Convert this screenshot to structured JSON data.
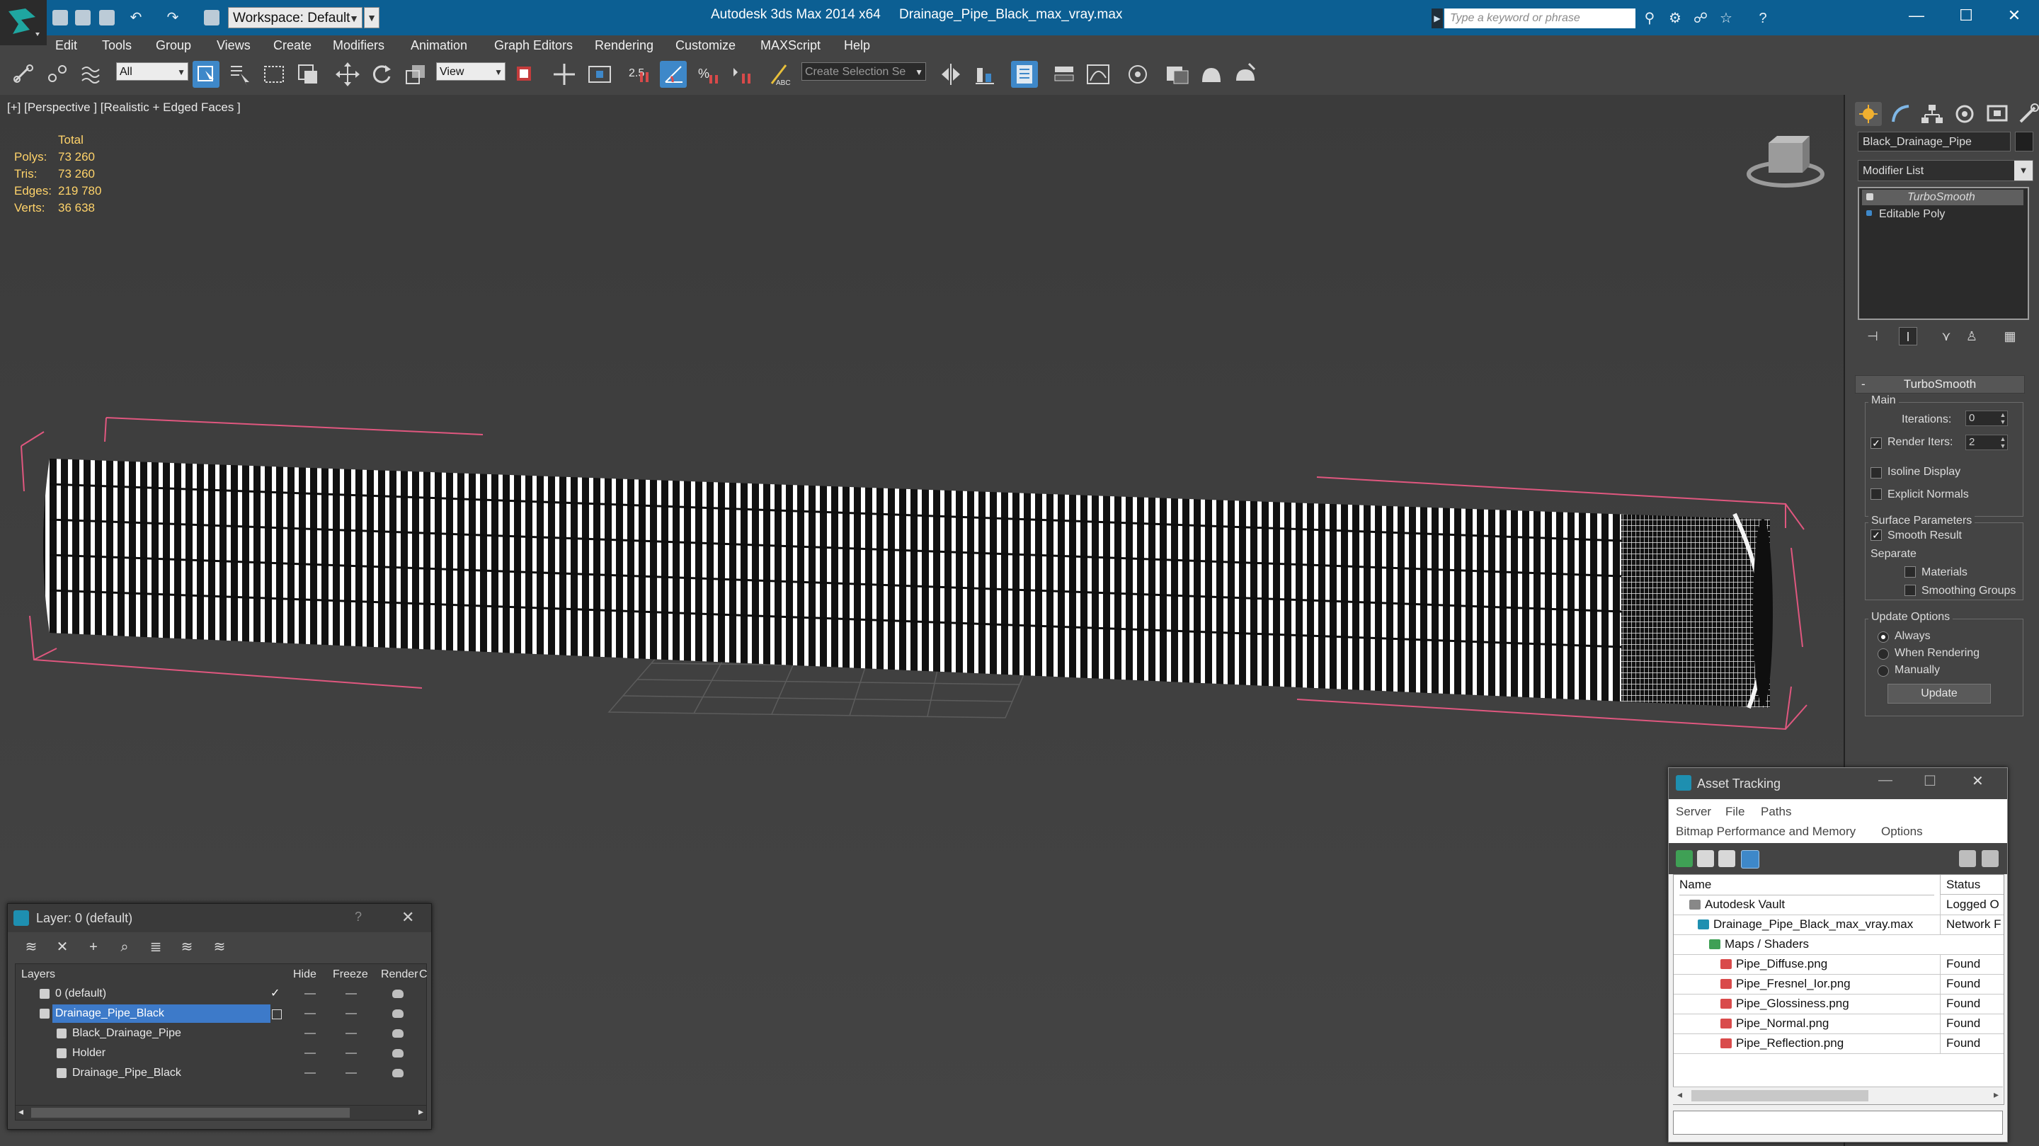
{
  "titlebar": {
    "workspace": "Workspace: Default",
    "app_title": "Autodesk 3ds Max  2014 x64",
    "file_title": "Drainage_Pipe_Black_max_vray.max",
    "search_placeholder": "Type a keyword or phrase",
    "minimize": "—",
    "maximize": "☐",
    "close": "✕"
  },
  "menu": [
    "Edit",
    "Tools",
    "Group",
    "Views",
    "Create",
    "Modifiers",
    "Animation",
    "Graph Editors",
    "Rendering",
    "Customize",
    "MAXScript",
    "Help"
  ],
  "toolbar": {
    "selection_filter": "All",
    "reference_coord": "View",
    "create_selection_set": "Create Selection Se",
    "snap_label": "2.5"
  },
  "viewport": {
    "label": "[+] [Perspective ] [Realistic + Edged Faces ]",
    "stats": {
      "header": "Total",
      "rows": [
        {
          "key": "Polys:",
          "value": "73 260"
        },
        {
          "key": "Tris:",
          "value": "73 260"
        },
        {
          "key": "Edges:",
          "value": "219 780"
        },
        {
          "key": "Verts:",
          "value": "36 638"
        }
      ]
    }
  },
  "command_panel": {
    "object_name": "Black_Drainage_Pipe",
    "modifier_list": "Modifier List",
    "stack": [
      "TurboSmooth",
      "Editable Poly"
    ],
    "rollout_title": "TurboSmooth",
    "main_group": "Main",
    "iterations_label": "Iterations:",
    "iterations_value": "0",
    "render_iters_label": "Render Iters:",
    "render_iters_value": "2",
    "isoline_display": "Isoline Display",
    "explicit_normals": "Explicit Normals",
    "surface_params": "Surface Parameters",
    "smooth_result": "Smooth Result",
    "separate": "Separate",
    "materials": "Materials",
    "smoothing_groups": "Smoothing Groups",
    "update_options": "Update Options",
    "always": "Always",
    "when_rendering": "When Rendering",
    "manually": "Manually",
    "update_button": "Update"
  },
  "layer_dialog": {
    "title": "Layer: 0 (default)",
    "help": "?",
    "close": "✕",
    "columns": {
      "layers": "Layers",
      "hide": "Hide",
      "freeze": "Freeze",
      "render": "Render",
      "c": "C"
    },
    "rows": [
      {
        "name": "0 (default)"
      },
      {
        "name": "Drainage_Pipe_Black"
      },
      {
        "name": "Black_Drainage_Pipe"
      },
      {
        "name": "Holder"
      },
      {
        "name": "Drainage_Pipe_Black"
      }
    ]
  },
  "asset_tracking": {
    "title": "Asset Tracking",
    "menu_row1": [
      "Server",
      "File",
      "Paths"
    ],
    "menu_row2": [
      "Bitmap Performance and Memory",
      "Options"
    ],
    "columns": {
      "name": "Name",
      "status": "Status"
    },
    "rows": [
      {
        "name": "Autodesk Vault",
        "status": "Logged O"
      },
      {
        "name": "Drainage_Pipe_Black_max_vray.max",
        "status": "Network F"
      },
      {
        "name": "Maps / Shaders",
        "status": ""
      },
      {
        "name": "Pipe_Diffuse.png",
        "status": "Found"
      },
      {
        "name": "Pipe_Fresnel_Ior.png",
        "status": "Found"
      },
      {
        "name": "Pipe_Glossiness.png",
        "status": "Found"
      },
      {
        "name": "Pipe_Normal.png",
        "status": "Found"
      },
      {
        "name": "Pipe_Reflection.png",
        "status": "Found"
      }
    ]
  },
  "colors": {
    "title_bar": "#0c5f93",
    "selection_blue": "#3d7ac9",
    "stats_yellow": "#ffd36a",
    "bbox_pink": "#e0577f"
  }
}
